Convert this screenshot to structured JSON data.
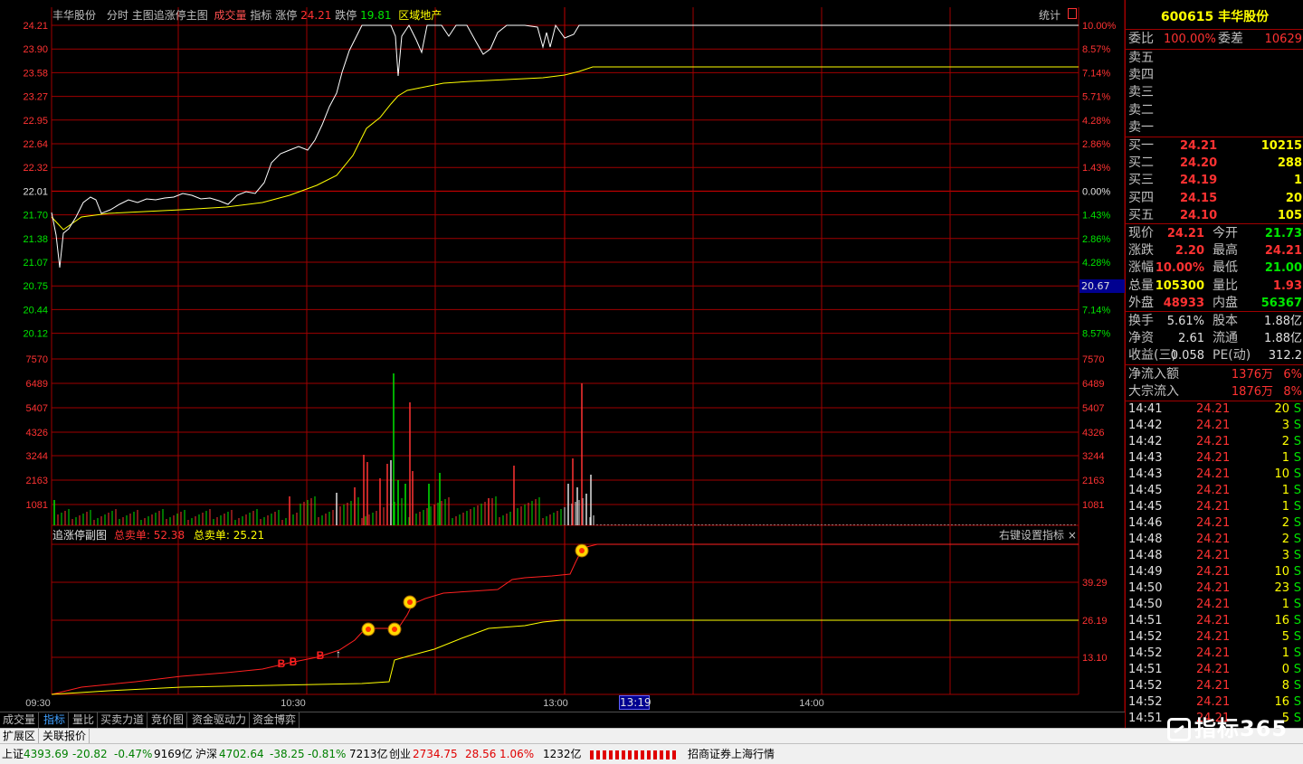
{
  "header": {
    "stock_name": "丰华股份",
    "items": [
      "分时",
      "主图",
      "追涨停主图"
    ],
    "volume_label": "成交量",
    "indicator_label": "指标",
    "limit_up_label": "涨停",
    "limit_up": "24.21",
    "limit_down_label": "跌停",
    "limit_down": "19.81",
    "sector": "区域地产",
    "stats": "统计"
  },
  "price_axis": {
    "left": [
      "24.21",
      "23.90",
      "23.58",
      "23.27",
      "22.95",
      "22.64",
      "22.32",
      "22.01",
      "21.70",
      "21.38",
      "21.07",
      "20.75",
      "20.44",
      "20.12"
    ],
    "right": [
      "10.00%",
      "8.57%",
      "7.14%",
      "5.71%",
      "4.28%",
      "2.86%",
      "1.43%",
      "0.00%",
      "1.43%",
      "2.86%",
      "4.28%",
      "20.67",
      "7.14%",
      "8.57%"
    ]
  },
  "volume_axis": [
    "7570",
    "6489",
    "5407",
    "4326",
    "3244",
    "2163",
    "1081"
  ],
  "sub_chart": {
    "title": "追涨停副图",
    "sell_label_1": "总卖单:",
    "sell_value_1": "52.38",
    "sell_label_2": "总卖单:",
    "sell_value_2": "25.21",
    "settings": "右键设置指标",
    "close": "×",
    "axis": [
      "39.29",
      "26.19",
      "13.10"
    ],
    "marks": [
      "B",
      "B",
      "B",
      "↑"
    ]
  },
  "time_axis": [
    "09:30",
    "10:30",
    "13:00",
    "14:00"
  ],
  "cursor_time": "13:19",
  "tabs": [
    "成交量",
    "指标",
    "量比",
    "买卖力道",
    "竞价图",
    "资金驱动力",
    "资金博弈"
  ],
  "tabs2": [
    "扩展区",
    "关联报价"
  ],
  "side": {
    "code": "600615",
    "name": "丰华股份",
    "wb_label": "委比",
    "wb": "100.00%",
    "wc_label": "委差",
    "wc": "10629",
    "sells": [
      "卖五",
      "卖四",
      "卖三",
      "卖二",
      "卖一"
    ],
    "buys": [
      {
        "label": "买一",
        "price": "24.21",
        "vol": "10215"
      },
      {
        "label": "买二",
        "price": "24.20",
        "vol": "288"
      },
      {
        "label": "买三",
        "price": "24.19",
        "vol": "1"
      },
      {
        "label": "买四",
        "price": "24.15",
        "vol": "20"
      },
      {
        "label": "买五",
        "price": "24.10",
        "vol": "105"
      }
    ],
    "quote": [
      {
        "l1": "现价",
        "v1": "24.21",
        "c1": "red",
        "l2": "今开",
        "v2": "21.73",
        "c2": "grn"
      },
      {
        "l1": "涨跌",
        "v1": "2.20",
        "c1": "red",
        "l2": "最高",
        "v2": "24.21",
        "c2": "red"
      },
      {
        "l1": "涨幅",
        "v1": "10.00%",
        "c1": "red",
        "l2": "最低",
        "v2": "21.00",
        "c2": "grn"
      },
      {
        "l1": "总量",
        "v1": "105300",
        "c1": "yel",
        "l2": "量比",
        "v2": "1.93",
        "c2": "red"
      },
      {
        "l1": "外盘",
        "v1": "48933",
        "c1": "red",
        "l2": "内盘",
        "v2": "56367",
        "c2": "grn"
      }
    ],
    "info": [
      {
        "l1": "换手",
        "v1": "5.61%",
        "l2": "股本",
        "v2": "1.88亿"
      },
      {
        "l1": "净资",
        "v1": "2.61",
        "l2": "流通",
        "v2": "1.88亿"
      },
      {
        "l1": "收益(三)",
        "v1": "0.058",
        "l2": "PE(动)",
        "v2": "312.2"
      }
    ],
    "flow": [
      {
        "l": "净流入额",
        "v": "1376万",
        "p": "6%"
      },
      {
        "l": "大宗流入",
        "v": "1876万",
        "p": "8%"
      }
    ],
    "ticks": [
      {
        "t": "14:41",
        "p": "24.21",
        "v": "20",
        "s": "S"
      },
      {
        "t": "14:42",
        "p": "24.21",
        "v": "3",
        "s": "S"
      },
      {
        "t": "14:42",
        "p": "24.21",
        "v": "2",
        "s": "S"
      },
      {
        "t": "14:43",
        "p": "24.21",
        "v": "1",
        "s": "S"
      },
      {
        "t": "14:43",
        "p": "24.21",
        "v": "10",
        "s": "S"
      },
      {
        "t": "14:45",
        "p": "24.21",
        "v": "1",
        "s": "S"
      },
      {
        "t": "14:45",
        "p": "24.21",
        "v": "1",
        "s": "S"
      },
      {
        "t": "14:46",
        "p": "24.21",
        "v": "2",
        "s": "S"
      },
      {
        "t": "14:48",
        "p": "24.21",
        "v": "2",
        "s": "S"
      },
      {
        "t": "14:48",
        "p": "24.21",
        "v": "3",
        "s": "S"
      },
      {
        "t": "14:49",
        "p": "24.21",
        "v": "10",
        "s": "S"
      },
      {
        "t": "14:50",
        "p": "24.21",
        "v": "23",
        "s": "S"
      },
      {
        "t": "14:50",
        "p": "24.21",
        "v": "1",
        "s": "S"
      },
      {
        "t": "14:51",
        "p": "24.21",
        "v": "16",
        "s": "S"
      },
      {
        "t": "14:52",
        "p": "24.21",
        "v": "5",
        "s": "S"
      },
      {
        "t": "14:52",
        "p": "24.21",
        "v": "1",
        "s": "S"
      },
      {
        "t": "14:51",
        "p": "24.21",
        "v": "0",
        "s": "S"
      },
      {
        "t": "14:52",
        "p": "24.21",
        "v": "8",
        "s": "S"
      },
      {
        "t": "14:52",
        "p": "24.21",
        "v": "16",
        "s": "S"
      },
      {
        "t": "14:51",
        "p": "24.21",
        "v": "5",
        "s": "S"
      }
    ]
  },
  "status": {
    "sh_label": "上证",
    "sh": "4393.69",
    "sh_chg": "-20.82",
    "sh_pct": "-0.47%",
    "sh_amt": "9169亿",
    "hs_label": "沪深",
    "hs": "4702.64",
    "hs_chg": "-38.25",
    "hs_pct": "-0.81%",
    "hs_amt": "7213亿",
    "cy_label": "创业",
    "cy": "2734.75",
    "cy_chg": "28.56",
    "cy_pct": "1.06%",
    "cy_amt": "1232亿",
    "broker": "招商证券上海行情"
  },
  "logo": "指标365",
  "colors": {
    "bg": "#000000",
    "grid": "#a00000",
    "price": "#ffffff",
    "avg": "#ffff00",
    "up": "#ff3232",
    "down": "#00e600"
  }
}
